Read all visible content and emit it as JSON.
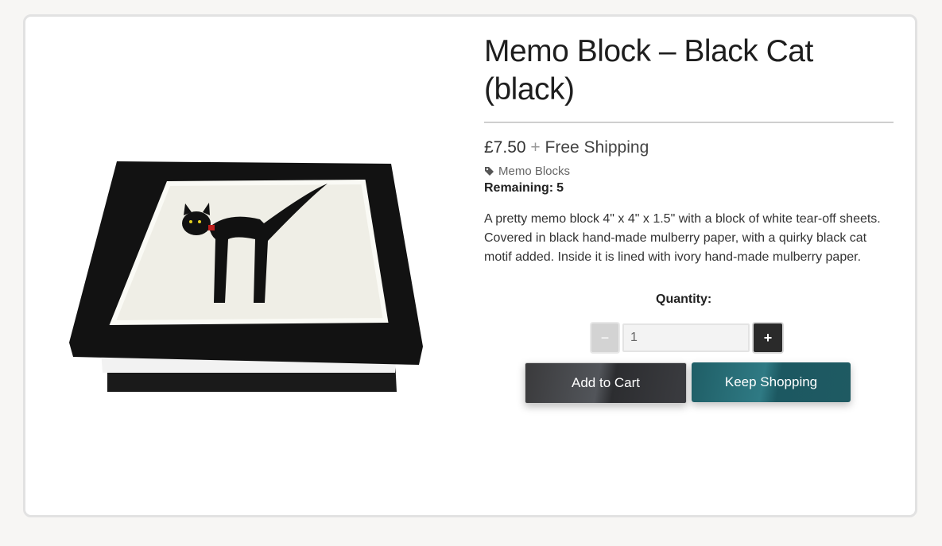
{
  "product": {
    "title": "Memo Block – Black Cat (black)",
    "price": "£7.50",
    "shipping_plus": "+",
    "shipping": "Free Shipping",
    "category_icon": "tag-icon",
    "category": "Memo Blocks",
    "remaining_label": "Remaining:",
    "remaining_value": "5",
    "description": "A pretty memo block 4\" x 4\" x 1.5\" with a block of white tear-off sheets. Covered in black hand-made mulberry paper, with a quirky black cat motif added. Inside it is lined with ivory hand-made mulberry paper."
  },
  "quantity": {
    "label": "Quantity:",
    "minus": "−",
    "value": "1",
    "plus": "+"
  },
  "buttons": {
    "add_to_cart": "Add to Cart",
    "keep_shopping": "Keep Shopping"
  },
  "colors": {
    "cart_button": "#3b3c40",
    "shop_button": "#1f5e66"
  }
}
